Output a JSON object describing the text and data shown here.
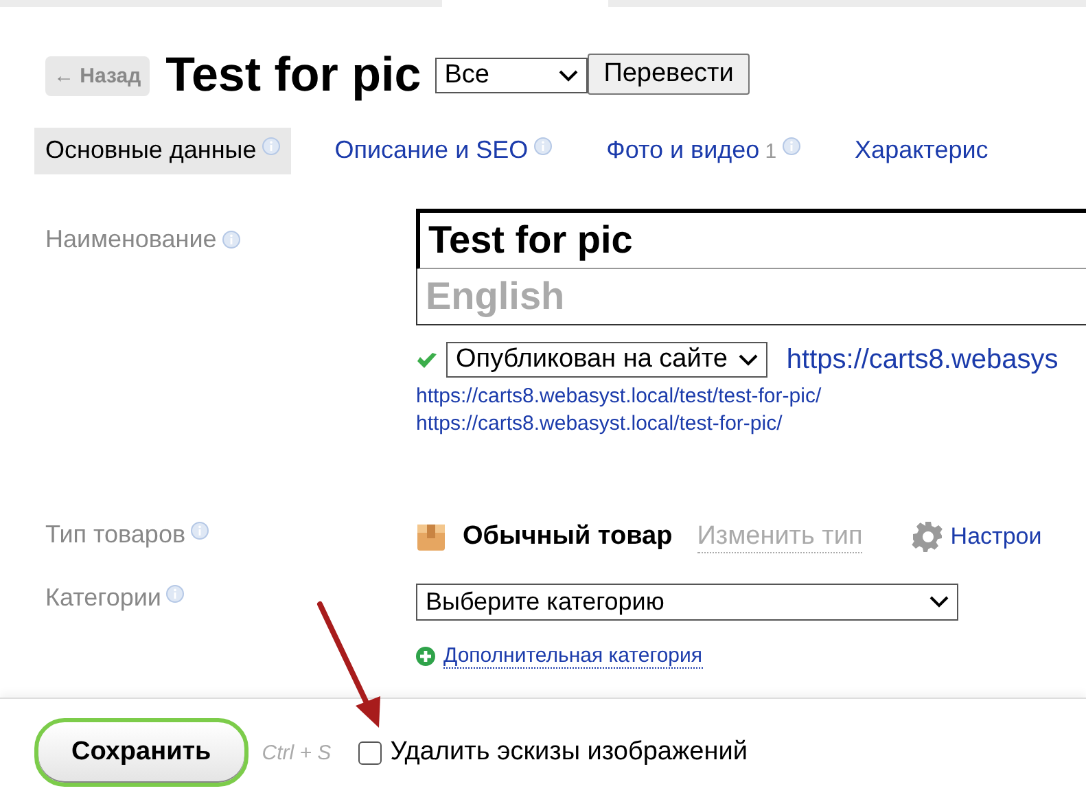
{
  "header": {
    "back_button": "← Назад",
    "title": "Test for pic",
    "language_select": "Все",
    "translate_button": "Перевести"
  },
  "tabs": [
    {
      "label": "Основные данные",
      "info": true,
      "selected": true
    },
    {
      "label": "Описание и SEO",
      "info": true,
      "selected": false
    },
    {
      "label": "Фото и видео",
      "count": "1",
      "info": true,
      "selected": false
    },
    {
      "label": "Характерис",
      "info": false,
      "selected": false
    }
  ],
  "name": {
    "label": "Наименование",
    "value": "Test for pic",
    "placeholder": "English"
  },
  "status": {
    "published": true,
    "select": "Опубликован на сайте",
    "link": "https://carts8.webasys",
    "urls": [
      "https://carts8.webasyst.local/test/test-for-pic/",
      "https://carts8.webasyst.local/test-for-pic/"
    ]
  },
  "product_type": {
    "label": "Тип товаров",
    "value": "Обычный товар",
    "change_link": "Изменить тип",
    "settings_link": "Настрои"
  },
  "categories": {
    "label": "Категории",
    "select": "Выберите категорию",
    "add_link": "Дополнительная категория"
  },
  "footer": {
    "save_button": "Сохранить",
    "shortcut": "Ctrl + S",
    "checkbox": {
      "label": "Удалить эскизы изображений",
      "checked": false
    }
  }
}
